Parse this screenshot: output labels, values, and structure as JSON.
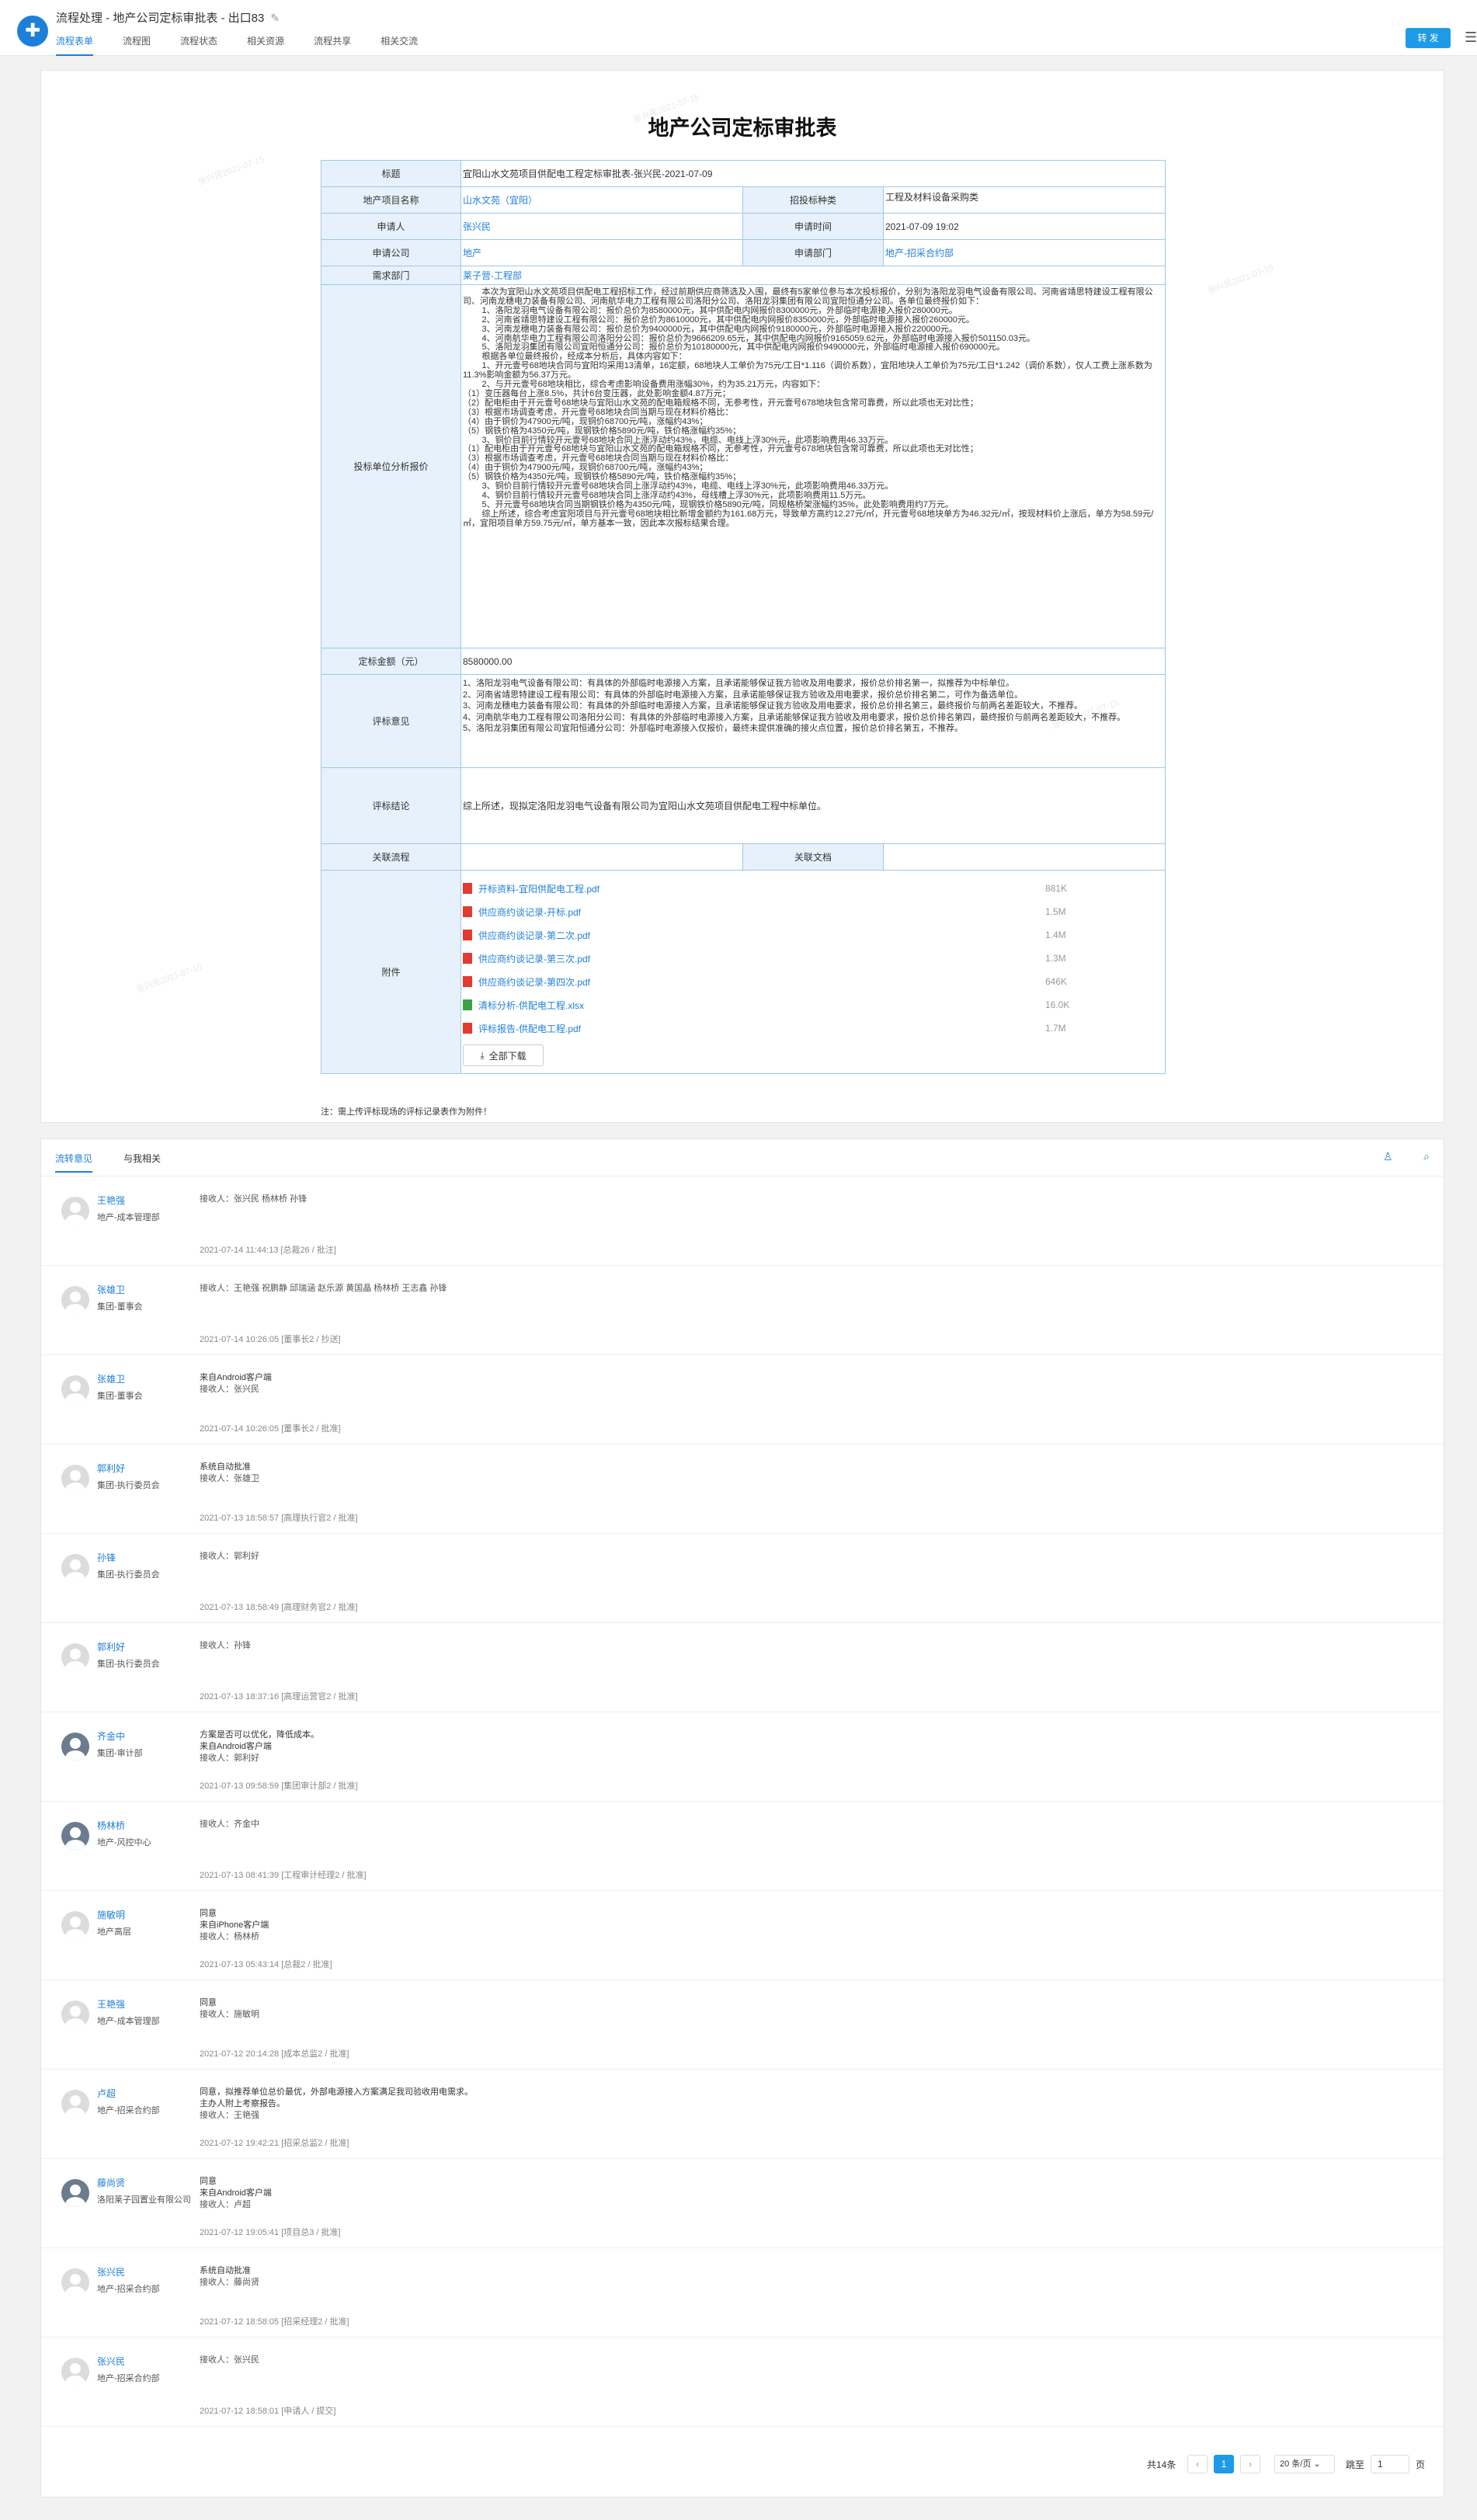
{
  "app": {
    "title": "流程处理 - 地产公司定标审批表 - 出口83",
    "logo": "✚",
    "tabs": [
      "流程表单",
      "流程图",
      "流程状态",
      "相关资源",
      "流程共享",
      "相关交流"
    ],
    "send_label": "转 发",
    "menu_icon": "☰"
  },
  "form": {
    "title": "地产公司定标审批表",
    "fields": {
      "subject_label": "标题",
      "subject": "宜阳山水文苑项目供配电工程定标审批表-张兴民-2021-07-09",
      "project_label": "地产项目名称",
      "project": "山水文苑（宜阳）",
      "bid_type_label": "招投标种类",
      "bid_type": "工程及材料设备采购类",
      "applicant_label": "申请人",
      "applicant": "张兴民",
      "apply_time_label": "申请时间",
      "apply_time": "2021-07-09 19:02",
      "company_label": "申请公司",
      "company": "地产",
      "dept_label": "申请部门",
      "dept": "地产-招采合约部",
      "demand_dept_label": "需求部门",
      "demand_dept": "莱子营-工程部",
      "analysis_label": "投标单位分析报价",
      "analysis": "        本次为宜阳山水文苑项目供配电工程招标工作，经过前期供应商筛选及入围，最终有5家单位参与本次投标报价，分别为洛阳龙羽电气设备有限公司、河南省靖思特建设工程有限公司、河南龙穗电力装备有限公司、河南航华电力工程有限公司洛阳分公司、洛阳龙羽集团有限公司宜阳恒通分公司。各单位最终报价如下：\n        1、洛阳龙羽电气设备有限公司：报价总价为8580000元，其中供配电内网报价8300000元，外部临时电源接入报价280000元。\n        2、河南省靖思特建设工程有限公司：报价总价为8610000元，其中供配电内网报价8350000元，外部临时电源接入报价260000元。\n        3、河南龙穗电力装备有限公司：报价总价为9400000元，其中供配电内网报价9180000元，外部临时电源接入报价220000元。\n        4、河南航华电力工程有限公司洛阳分公司：报价总价为9666209.65元，其中供配电内网报价9165059.62元，外部临时电源接入报价501150.03元。\n        5、洛阳龙羽集团有限公司宜阳恒通分公司：报价总价为10180000元，其中供配电内网报价9490000元，外部临时电源接入报价690000元。\n        根据各单位最终报价，经成本分析后，具体内容如下：\n        1、开元壹号68地块合同与宜阳均采用13清单，16定额，68地块人工单价为75元/工日*1.116（调价系数），宜阳地块人工单价为75元/工日*1.242（调价系数），仅人工费上涨系数为11.3%影响金额为56.37万元。\n        2、与开元壹号68地块相比，综合考虑影响设备费用涨幅30%，约为35.21万元，内容如下：\n（1）变压器每台上涨8.5%，共计6台变压器，此处影响金额4.87万元；\n（2）配电柜由于开元壹号68地块与宜阳山水文苑的配电箱规格不同，无参考性，开元壹号678地块包含常可靠费，所以此项也无对比性；\n（3）根据市场调查考虑，开元壹号68地块合同当期与现在材料价格比：\n（4）由于铜价为47900元/吨，现铜价68700元/吨，涨幅约43%；\n（5）钢铁价格为4350元/吨，现钢铁价格5890元/吨，铁价格涨幅约35%；\n        3、铜价目前行情较开元壹号68地块合同上涨浮动约43%，电缆、电线上浮30%元，此项影响费用46.33万元。\n（1）配电柜由于开元壹号68地块与宜阳山水文苑的配电箱规格不同，无参考性，开元壹号678地块包含常可靠费，所以此项也无对比性；\n（3）根据市场调查考虑，开元壹号68地块合同当期与现在材料价格比：\n（4）由于铜价为47900元/吨，现铜价68700元/吨，涨幅约43%；\n（5）钢铁价格为4350元/吨，现钢铁价格5890元/吨，铁价格涨幅约35%；\n        3、铜价目前行情较开元壹号68地块合同上涨浮动约43%，电缆、电线上浮30%元，此项影响费用46.33万元。\n        4、钢价目前行情较开元壹号68地块合同上涨浮动约43%，母线槽上浮30%元，此项影响费用11.5万元。\n        5、开元壹号68地块合同当期钢铁价格为4350元/吨，现钢铁价格5890元/吨，同规格桥架涨幅约35%，此处影响费用约7万元。\n        综上所述，综合考虑宜阳项目与开元壹号68地块相比新增金额约为161.68万元，导致单方高约12.27元/㎡，开元壹号68地块单方为46.32元/㎡，按现材料价上涨后，单方为58.59元/㎡，宜阳项目单方59.75元/㎡，单方基本一致，因此本次报标结果合理。",
      "amount_label": "定标金额（元）",
      "amount": "8580000.00",
      "opinion_label": "评标意见",
      "opinion": "1、洛阳龙羽电气设备有限公司：有具体的外部临时电源接入方案，且承诺能够保证我方验收及用电要求，报价总价排名第一，拟推荐为中标单位。\n2、河南省靖思特建设工程有限公司：有具体的外部临时电源接入方案，且承诺能够保证我方验收及用电要求，报价总价排名第二，可作为备选单位。\n3、河南龙穗电力装备有限公司：有具体的外部临时电源接入方案，且承诺能够保证我方验收及用电要求，报价总价排名第三，最终报价与前两名差距较大，不推荐。\n4、河南航华电力工程有限公司洛阳分公司：有具体的外部临时电源接入方案，且承诺能够保证我方验收及用电要求，报价总价排名第四，最终报价与前两名差距较大，不推荐。\n5、洛阳龙羽集团有限公司宜阳恒通分公司：外部临时电源接入仅报价，最终未提供准确的接火点位置，报价总价排名第五，不推荐。",
      "conclusion_label": "评标结论",
      "conclusion": "综上所述，现拟定洛阳龙羽电气设备有限公司为宜阳山水文苑项目供配电工程中标单位。",
      "related_flow_label": "关联流程",
      "related_doc_label": "关联文档",
      "attachments_label": "附件",
      "download_all": "全部下载"
    },
    "attachments": [
      {
        "name": "开标资料-宜阳供配电工程.pdf",
        "size": "881K",
        "type": "pdf"
      },
      {
        "name": "供应商约谈记录-开标.pdf",
        "size": "1.5M",
        "type": "pdf"
      },
      {
        "name": "供应商约谈记录-第二次.pdf",
        "size": "1.4M",
        "type": "pdf"
      },
      {
        "name": "供应商约谈记录-第三次.pdf",
        "size": "1.3M",
        "type": "pdf"
      },
      {
        "name": "供应商约谈记录-第四次.pdf",
        "size": "646K",
        "type": "pdf"
      },
      {
        "name": "清标分析-供配电工程.xlsx",
        "size": "16.0K",
        "type": "xlsx"
      },
      {
        "name": "评标报告-供配电工程.pdf",
        "size": "1.7M",
        "type": "pdf"
      }
    ],
    "footnote": "注：需上传评标现场的评标记录表作为附件！",
    "watermark": "张兴民2021-07-15"
  },
  "comments": {
    "tabs": [
      "流转意见",
      "与我相关"
    ],
    "items": [
      {
        "name": "王艳强",
        "dept": "地产-成本管理部",
        "body": [
          "接收人：张兴民 杨林桥 孙锋"
        ],
        "meta": "2021-07-14 11:44:13  [总裁26 / 批注]"
      },
      {
        "name": "张雄卫",
        "dept": "集团-董事会",
        "body": [
          "接收人：王艳强 祝鹏静 邱瑞涵 赵乐源 黄国晶 杨林桥 王志鑫 孙锋"
        ],
        "meta": "2021-07-14 10:26:05  [董事长2 / 抄送]"
      },
      {
        "name": "张雄卫",
        "dept": "集团-董事会",
        "body": [
          "来自Android客户端",
          "接收人：张兴民"
        ],
        "meta": "2021-07-14 10:26:05  [董事长2 / 批准]"
      },
      {
        "name": "郭利好",
        "dept": "集团-执行委员会",
        "body": [
          "系统自动批准",
          "接收人：张雄卫"
        ],
        "meta": "2021-07-13 18:58:57  [高理执行官2 / 批准]"
      },
      {
        "name": "孙锋",
        "dept": "集团-执行委员会",
        "body": [
          "接收人：郭利好"
        ],
        "meta": "2021-07-13 18:58:49  [高理财务官2 / 批准]"
      },
      {
        "name": "郭利好",
        "dept": "集团-执行委员会",
        "body": [
          "接收人：孙锋"
        ],
        "meta": "2021-07-13 18:37:16  [高理运营官2 / 批准]"
      },
      {
        "name": "齐金中",
        "dept": "集团-审计部",
        "body": [
          "方案是否可以优化，降低成本。",
          "来自Android客户端",
          "接收人：郭利好"
        ],
        "meta": "2021-07-13 09:58:59  [集团审计部2 / 批准]",
        "photo": true
      },
      {
        "name": "杨林桥",
        "dept": "地产-风控中心",
        "body": [
          "接收人：齐金中"
        ],
        "meta": "2021-07-13 08:41:39  [工程审计经理2 / 批准]",
        "photo": true
      },
      {
        "name": "施敏明",
        "dept": "地产高层",
        "body": [
          "同意",
          "来自iPhone客户端",
          "接收人：杨林桥"
        ],
        "meta": "2021-07-13 05:43:14  [总裁2 / 批准]"
      },
      {
        "name": "王艳强",
        "dept": "地产-成本管理部",
        "body": [
          "同意",
          "接收人：施敏明"
        ],
        "meta": "2021-07-12 20:14:28  [成本总监2 / 批准]"
      },
      {
        "name": "卢超",
        "dept": "地产-招采合约部",
        "body": [
          "同意，拟推荐单位总价最优，外部电源接入方案满足我司验收用电需求。",
          "主办人附上考察报告。",
          "接收人：王艳强"
        ],
        "meta": "2021-07-12 19:42:21  [招采总监2 / 批准]"
      },
      {
        "name": "藤尚贤",
        "dept": "洛阳莱子园置业有限公司",
        "body": [
          "同意",
          "来自Android客户端",
          "接收人：卢超"
        ],
        "meta": "2021-07-12 19:05:41  [项目总3 / 批准]",
        "photo": true
      },
      {
        "name": "张兴民",
        "dept": "地产-招采合约部",
        "body": [
          "系统自动批准",
          "接收人：藤尚贤"
        ],
        "meta": "2021-07-12 18:58:05  [招采经理2 / 批准]"
      },
      {
        "name": "张兴民",
        "dept": "地产-招采合约部",
        "body": [
          "接收人：张兴民"
        ],
        "meta": "2021-07-12 18:58:01  [申请人 / 提交]"
      }
    ]
  },
  "pagination": {
    "total": "共14条",
    "prev": "‹",
    "current": "1",
    "next": "›",
    "page_size": "20 条/页 ⌄",
    "jump_label": "跳至",
    "jump_value": "1",
    "unit": "页"
  }
}
